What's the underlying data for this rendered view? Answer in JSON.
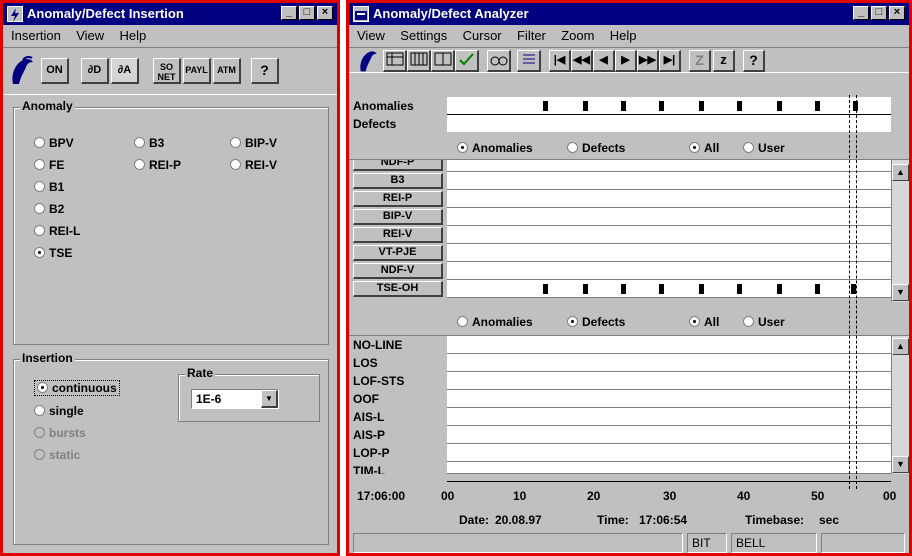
{
  "insertion_window": {
    "title": "Anomaly/Defect Insertion",
    "menu": [
      "Insertion",
      "View",
      "Help"
    ],
    "toolbar": {
      "on": "ON",
      "delta_d": "∂D",
      "delta_a": "∂A",
      "sonet": "SO NET",
      "payl": "PAYL",
      "atm": "ATM",
      "help": "?"
    },
    "anomaly": {
      "title": "Anomaly",
      "options": [
        "BPV",
        "B3",
        "BIP-V",
        "FE",
        "REI-P",
        "REI-V",
        "B1",
        "B2",
        "REI-L",
        "TSE"
      ],
      "selected": "TSE"
    },
    "insertion": {
      "title": "Insertion",
      "options": [
        "continuous",
        "single",
        "bursts",
        "static"
      ],
      "selected": "continuous",
      "disabled": [
        "bursts",
        "static"
      ]
    },
    "rate": {
      "title": "Rate",
      "value": "1E-6"
    }
  },
  "analyzer_window": {
    "title": "Anomaly/Defect Analyzer",
    "menu": [
      "View",
      "Settings",
      "Cursor",
      "Filter",
      "Zoom",
      "Help"
    ],
    "toolbar": {
      "z1": "Z",
      "z2": "z",
      "help": "?"
    },
    "overview": {
      "rows": [
        "Anomalies",
        "Defects"
      ]
    },
    "filter1": {
      "anomalies": "Anomalies",
      "defects": "Defects",
      "all": "All",
      "user": "User",
      "selected": "Anomalies",
      "scope": "All"
    },
    "anomaly_rows": [
      "NDF-P",
      "B3",
      "REI-P",
      "BIP-V",
      "REI-V",
      "VT-PJE",
      "NDF-V",
      "TSE-OH"
    ],
    "filter2": {
      "anomalies": "Anomalies",
      "defects": "Defects",
      "all": "All",
      "user": "User",
      "selected": "Defects",
      "scope": "All"
    },
    "defect_rows": [
      "NO-LINE",
      "LOS",
      "LOF-STS",
      "OOF",
      "AIS-L",
      "AIS-P",
      "LOP-P",
      "TIM-L"
    ],
    "timeline": {
      "start": "17:06:00",
      "ticks": [
        "00",
        "10",
        "20",
        "30",
        "40",
        "50",
        "00"
      ]
    },
    "info": {
      "date_label": "Date:",
      "date": "20.08.97",
      "time_label": "Time:",
      "time": "17:06:54",
      "timebase_label": "Timebase:",
      "timebase": "sec"
    },
    "status": [
      "BIT",
      "BELL"
    ]
  },
  "colors": {
    "titlebar": "#000080",
    "frame_highlight": "#e00000",
    "face": "#c0c0c0"
  }
}
